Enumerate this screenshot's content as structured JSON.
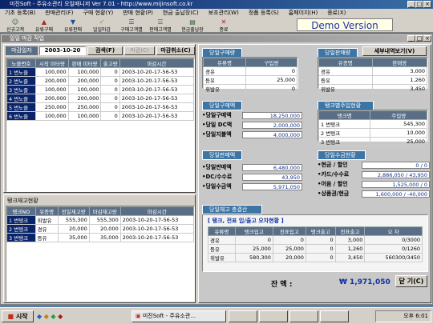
{
  "window": {
    "title": "미진Soft - 주유소관리 오일매니저 Ver 7.01 - http://www.mijinsoft.co.kr"
  },
  "menu": [
    "기초 등록(B)",
    "판매관리(F)",
    "구매 현황(Y)",
    "판매 현황(P)",
    "현금 출납장(C)",
    "보조관리(W)",
    "정품 등록(S)",
    "홈페이지(H)",
    "종료(X)"
  ],
  "toolbar": [
    {
      "label": "신규고객",
      "icon": "customer-icon"
    },
    {
      "label": "유류구매",
      "icon": "purchase-icon"
    },
    {
      "label": "유류판매",
      "icon": "sales-icon"
    },
    {
      "label": "일일마감",
      "icon": "daily-close-icon"
    },
    {
      "label": "구매고객별",
      "icon": "purchase-customer-icon"
    },
    {
      "label": "판매고객별",
      "icon": "sales-customer-icon"
    },
    {
      "label": "현금출납장",
      "icon": "cashbook-icon"
    },
    {
      "label": "종료",
      "icon": "exit-icon"
    }
  ],
  "demo": "Demo Version",
  "child": {
    "title": "일일 마감 작업"
  },
  "closing": {
    "date_label": "마감일자",
    "date": "2003-10-20",
    "search": "검색(F)",
    "close": "마감(C)",
    "cancel": "마감취소(C)",
    "headers": [
      "노즐번호",
      "시작 미터량",
      "판매 미터량",
      "출고량",
      "마감시간"
    ],
    "rows": [
      [
        "1 번노즐",
        "100,000",
        "100,000",
        "0",
        "2003-10-20-17-56-53"
      ],
      [
        "2 번노즐",
        "200,000",
        "200,000",
        "0",
        "2003-10-20-17-56-53"
      ],
      [
        "3 번노즐",
        "100,000",
        "100,000",
        "0",
        "2003-10-20-17-56-53"
      ],
      [
        "4 번노즐",
        "200,000",
        "200,000",
        "0",
        "2003-10-20-17-56-53"
      ],
      [
        "5 번노즐",
        "250,000",
        "250,000",
        "0",
        "2003-10-20-17-56-53"
      ],
      [
        "6 번노즐",
        "100,000",
        "100,000",
        "0",
        "2003-10-20-17-56-53"
      ]
    ]
  },
  "tank": {
    "title": "탱크재고현황",
    "headers": [
      "탱크NO",
      "유종명",
      "전일재고량",
      "마감재고량",
      "마감시간"
    ],
    "rows": [
      [
        "1 번탱크",
        "휘발유",
        "555,300",
        "555,300",
        "2003-10-20-17-56-53"
      ],
      [
        "2 번탱크",
        "경유",
        "20,000",
        "20,000",
        "2003-10-20-17-56-53"
      ],
      [
        "3 번탱크",
        "등유",
        "35,000",
        "35,000",
        "2003-10-20-17-56-53"
      ]
    ]
  },
  "purchase": {
    "title": "당일구매량",
    "headers": [
      "유류명",
      "구입량"
    ],
    "rows": [
      [
        "경유",
        "0"
      ],
      [
        "등유",
        "25,000"
      ],
      [
        "휘발유",
        "0"
      ]
    ]
  },
  "sales": {
    "title": "당일판매량",
    "button": "세부내역보기(V)",
    "headers": [
      "유종명",
      "판매량"
    ],
    "rows": [
      [
        "경유",
        "3,000"
      ],
      [
        "등유",
        "1,260"
      ],
      [
        "휘발유",
        "3,450"
      ]
    ]
  },
  "purchase_amt": {
    "title": "당일구매액",
    "items": [
      {
        "label": "•당일구매액",
        "value": "18,250,000"
      },
      {
        "label": "•당일 DC액",
        "value": "2,000,000"
      },
      {
        "label": "•당일지불액",
        "value": "4,000,000"
      }
    ]
  },
  "tank_in": {
    "title": "탱크별주입현황",
    "headers": [
      "탱크명",
      "주입량"
    ],
    "rows": [
      [
        "1 번탱크",
        "545,300"
      ],
      [
        "2 번탱크",
        "10,000"
      ],
      [
        "3 번탱크",
        "25,000"
      ]
    ]
  },
  "sales_amt": {
    "title": "당일판매액",
    "items": [
      {
        "label": "•당일판매액",
        "value": "6,480,000"
      },
      {
        "label": "•DC/수수료",
        "value": "43,950"
      },
      {
        "label": "•당일수금액",
        "value": "5,971,050"
      }
    ]
  },
  "collect": {
    "title": "당일수금현황",
    "items": [
      {
        "label": "•현금 / 할인",
        "value": "0 / 0"
      },
      {
        "label": "•카드/수수료",
        "value": "2,886,050 / 43,950"
      },
      {
        "label": "•어음 / 할인",
        "value": "1,525,000 / 0"
      },
      {
        "label": "•상품권/현금",
        "value": "1,600,000 / -40,000"
      }
    ]
  },
  "summary": {
    "title": "당일재고 총결산",
    "subtitle": "[ 탱크, 전표 입/출고 오차현황 ]",
    "headers": [
      "유류명",
      "탱크입고",
      "전표입고",
      "탱크출고",
      "전표출고",
      "오 차"
    ],
    "rows": [
      [
        "경유",
        "0",
        "0",
        "0",
        "3,000",
        "0/3000"
      ],
      [
        "등유",
        "25,000",
        "25,000",
        "0",
        "1,260",
        "0/1260"
      ],
      [
        "휘발유",
        "580,300",
        "20,000",
        "0",
        "3,450",
        "560300/3450"
      ]
    ],
    "balance_label": "잔   액 :",
    "balance": "₩  1,971,050",
    "close_btn": "닫 기(C)"
  },
  "taskbar": {
    "start": "시작",
    "items": [
      "미진Soft - 주유소관...",
      "",
      "",
      "",
      ""
    ],
    "clock": "오후 6:01"
  }
}
